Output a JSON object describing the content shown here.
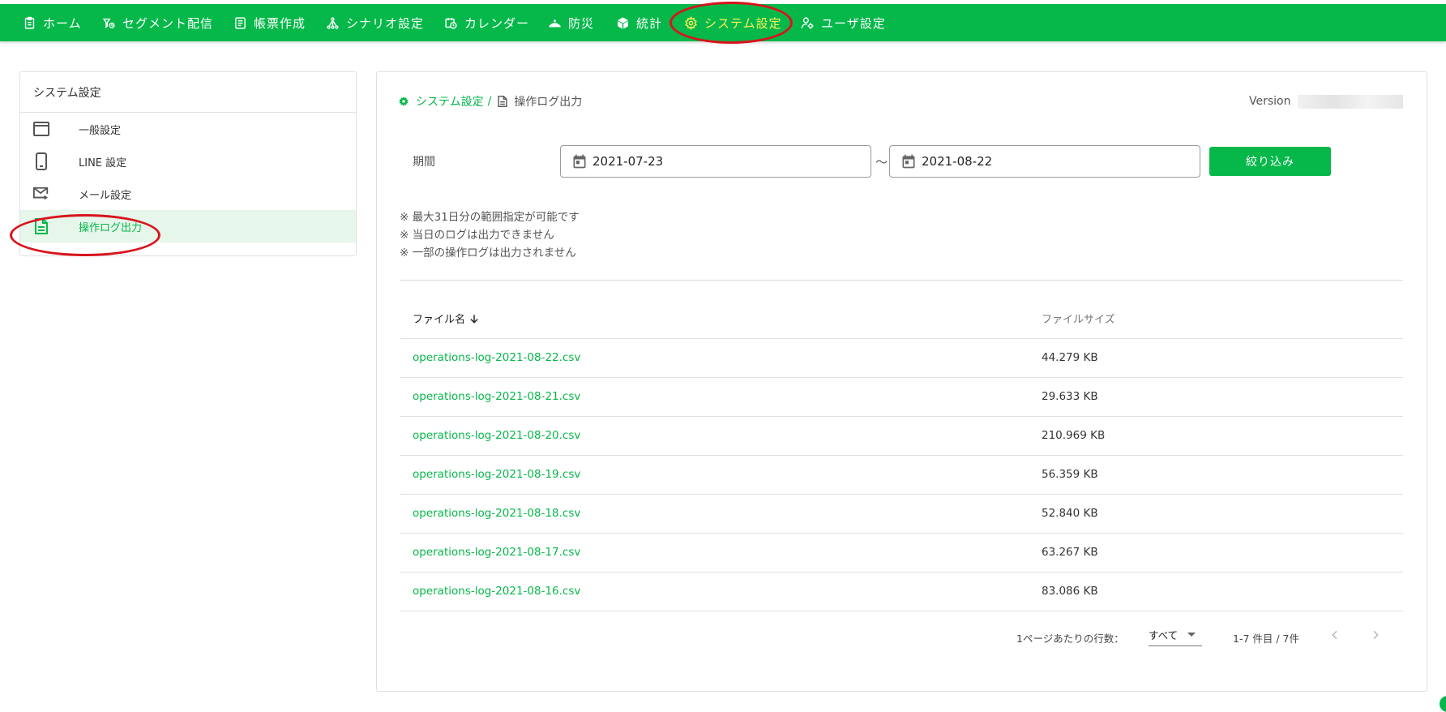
{
  "colors": {
    "brand_green": "#06b84a",
    "active_nav": "#fff15a",
    "annotation_red": "#d8141c"
  },
  "topnav": {
    "items": [
      {
        "label": "ホーム",
        "icon": "clipboard-icon"
      },
      {
        "label": "セグメント配信",
        "icon": "segment-delivery-icon"
      },
      {
        "label": "帳票作成",
        "icon": "form-icon"
      },
      {
        "label": "シナリオ設定",
        "icon": "scenario-icon"
      },
      {
        "label": "カレンダー",
        "icon": "calendar-clock-icon"
      },
      {
        "label": "防災",
        "icon": "disaster-icon"
      },
      {
        "label": "統計",
        "icon": "cube-icon"
      },
      {
        "label": "システム設定",
        "icon": "gear-icon",
        "active": true
      },
      {
        "label": "ユーザ設定",
        "icon": "user-gear-icon"
      }
    ]
  },
  "sidebar": {
    "title": "システム設定",
    "items": [
      {
        "label": "一般設定",
        "icon": "window-icon"
      },
      {
        "label": "LINE 設定",
        "icon": "phone-icon"
      },
      {
        "label": "メール設定",
        "icon": "mail-send-icon"
      },
      {
        "label": "操作ログ出力",
        "icon": "document-icon",
        "active": true
      }
    ]
  },
  "breadcrumb": {
    "parent": "システム設定",
    "separator": "/",
    "current": "操作ログ出力"
  },
  "version_label": "Version",
  "filter": {
    "period_label": "期間",
    "start_date": "2021-07-23",
    "end_date": "2021-08-22",
    "separator": "～",
    "button_label": "絞り込み"
  },
  "notes": [
    "※ 最大31日分の範囲指定が可能です",
    "※ 当日のログは出力できません",
    "※ 一部の操作ログは出力されません"
  ],
  "table": {
    "columns": {
      "name": "ファイル名",
      "size": "ファイルサイズ"
    },
    "rows": [
      {
        "name": "operations-log-2021-08-22.csv",
        "size": "44.279 KB"
      },
      {
        "name": "operations-log-2021-08-21.csv",
        "size": "29.633 KB"
      },
      {
        "name": "operations-log-2021-08-20.csv",
        "size": "210.969 KB"
      },
      {
        "name": "operations-log-2021-08-19.csv",
        "size": "56.359 KB"
      },
      {
        "name": "operations-log-2021-08-18.csv",
        "size": "52.840 KB"
      },
      {
        "name": "operations-log-2021-08-17.csv",
        "size": "63.267 KB"
      },
      {
        "name": "operations-log-2021-08-16.csv",
        "size": "83.086 KB"
      }
    ]
  },
  "pagination": {
    "rows_per_page_label": "1ページあたりの行数：",
    "rows_per_page_value": "すべて",
    "range_text": "1-7 件目 / 7件"
  }
}
